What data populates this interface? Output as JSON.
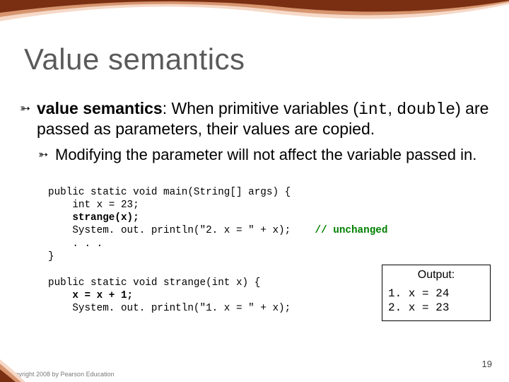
{
  "title": "Value semantics",
  "bullet": {
    "lead": "value semantics",
    "rest1": ": When primitive variables (",
    "code1": "int",
    "rest2": ", ",
    "code2": "double",
    "rest3": ") are passed as parameters, their values are copied."
  },
  "sub_bullet": "Modifying the parameter will not affect the variable passed in.",
  "code": {
    "l1": "public static void main(String[] args) {",
    "l2": "    int x = 23;",
    "l3": "    strange(x);",
    "l4a": "    System. out. println(\"2. x = \" + x);",
    "l4c": "    // unchanged",
    "l5": "    . . .",
    "l6": "}",
    "l7": "",
    "l8": "public static void strange(int x) {",
    "l9": "    x = x + 1;",
    "l10": "    System. out. println(\"1. x = \" + x);"
  },
  "output": {
    "header": "Output:",
    "line1": "1. x = 24",
    "line2": "2. x = 23"
  },
  "footer": "Copyright 2008 by Pearson Education",
  "page": "19",
  "colors": {
    "accent_light": "#f6d9c8",
    "accent_mid": "#d7956f",
    "accent_dark": "#7a2f12"
  }
}
